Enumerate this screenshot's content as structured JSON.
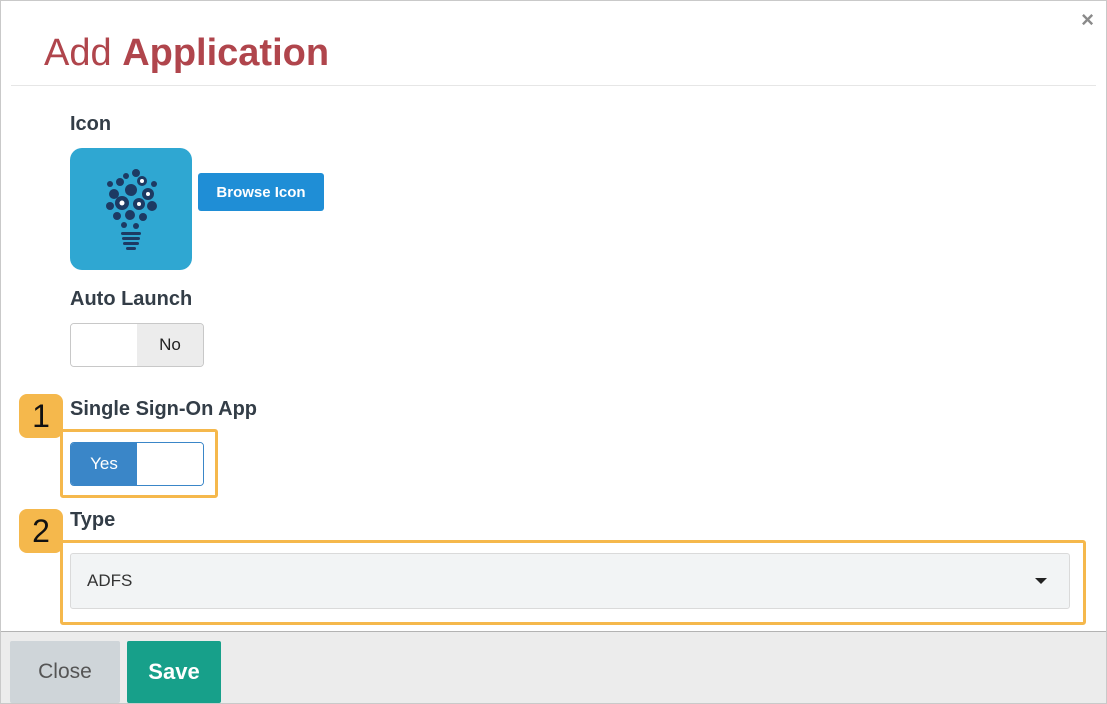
{
  "dialog": {
    "title_light": "Add",
    "title_bold": "Application",
    "close_glyph": "×"
  },
  "icon_field": {
    "label": "Icon",
    "icon_name": "lightbulb-icon",
    "browse_label": "Browse Icon"
  },
  "auto_launch": {
    "label": "Auto Launch",
    "value_label": "No",
    "checked": false
  },
  "sso": {
    "label": "Single Sign-On App",
    "value_label": "Yes",
    "checked": true
  },
  "type_field": {
    "label": "Type",
    "selected": "ADFS"
  },
  "callouts": [
    {
      "number": "1"
    },
    {
      "number": "2"
    }
  ],
  "footer": {
    "close_label": "Close",
    "save_label": "Save"
  },
  "colors": {
    "title": "#b0454c",
    "primary_button": "#1f8ed6",
    "toggle_on": "#3a86c8",
    "save_button": "#17a08a",
    "callout": "#f5b84c",
    "icon_tile": "#2fa7d2"
  }
}
